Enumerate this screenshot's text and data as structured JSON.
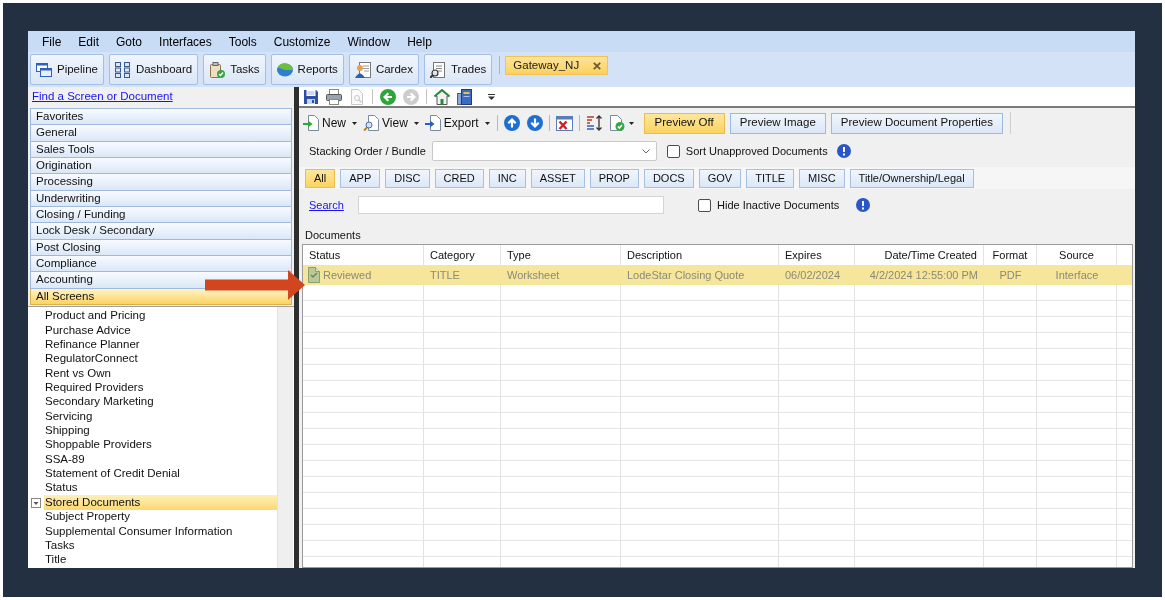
{
  "menu_bar": [
    "File",
    "Edit",
    "Goto",
    "Interfaces",
    "Tools",
    "Customize",
    "Window",
    "Help"
  ],
  "toolbar": [
    "Pipeline",
    "Dashboard",
    "Tasks",
    "Reports",
    "Cardex",
    "Trades"
  ],
  "open_tabs": [
    {
      "label": "Gateway_NJ",
      "selected": true
    }
  ],
  "left_panel": {
    "find_link": "Find a Screen or Document",
    "categories": [
      {
        "label": "Favorites",
        "selected": false
      },
      {
        "label": "General",
        "selected": false
      },
      {
        "label": "Sales Tools",
        "selected": false
      },
      {
        "label": "Origination",
        "selected": false
      },
      {
        "label": "Processing",
        "selected": false
      },
      {
        "label": "Underwriting",
        "selected": false
      },
      {
        "label": "Closing / Funding",
        "selected": false
      },
      {
        "label": "Lock Desk / Secondary",
        "selected": false
      },
      {
        "label": "Post Closing",
        "selected": false
      },
      {
        "label": "Compliance",
        "selected": false
      },
      {
        "label": "Accounting",
        "selected": false
      },
      {
        "label": "All Screens",
        "selected": true
      }
    ],
    "screens": [
      {
        "label": "Product and Pricing",
        "selected": false
      },
      {
        "label": "Purchase Advice",
        "selected": false
      },
      {
        "label": "Refinance Planner",
        "selected": false
      },
      {
        "label": "RegulatorConnect",
        "selected": false
      },
      {
        "label": "Rent vs Own",
        "selected": false
      },
      {
        "label": "Required Providers",
        "selected": false
      },
      {
        "label": "Secondary Marketing",
        "selected": false
      },
      {
        "label": "Servicing",
        "selected": false
      },
      {
        "label": "Shipping",
        "selected": false
      },
      {
        "label": "Shoppable Providers",
        "selected": false
      },
      {
        "label": "SSA-89",
        "selected": false
      },
      {
        "label": "Statement of Credit Denial",
        "selected": false
      },
      {
        "label": "Status",
        "selected": false
      },
      {
        "label": "Stored Documents",
        "selected": true
      },
      {
        "label": "Subject Property",
        "selected": false
      },
      {
        "label": "Supplemental Consumer Information",
        "selected": false
      },
      {
        "label": "Tasks",
        "selected": false
      },
      {
        "label": "Title",
        "selected": false
      }
    ]
  },
  "quick_toolbar": [
    {
      "disabled": false
    },
    {
      "disabled": false
    },
    {
      "disabled": true
    },
    {
      "disabled": false
    },
    {
      "disabled": true
    },
    {
      "disabled": false
    },
    {
      "disabled": false
    }
  ],
  "document_toolbar": {
    "menus": [
      "New",
      "View",
      "Export"
    ],
    "preview_buttons": [
      {
        "label": "Preview Off",
        "selected": true
      },
      {
        "label": "Preview Image",
        "selected": false
      },
      {
        "label": "Preview Document Properties",
        "selected": false
      }
    ]
  },
  "stacking_order": {
    "label": "Stacking Order / Bundle"
  },
  "sort_unapproved": {
    "label": "Sort Unapproved Documents",
    "checked": false
  },
  "filters": [
    {
      "label": "All",
      "selected": true
    },
    {
      "label": "APP",
      "selected": false
    },
    {
      "label": "DISC",
      "selected": false
    },
    {
      "label": "CRED",
      "selected": false
    },
    {
      "label": "INC",
      "selected": false
    },
    {
      "label": "ASSET",
      "selected": false
    },
    {
      "label": "PROP",
      "selected": false
    },
    {
      "label": "DOCS",
      "selected": false
    },
    {
      "label": "GOV",
      "selected": false
    },
    {
      "label": "TITLE",
      "selected": false
    },
    {
      "label": "MISC",
      "selected": false
    },
    {
      "label": "Title/Ownership/Legal",
      "selected": false
    }
  ],
  "search": {
    "link": "Search"
  },
  "hide_inactive": {
    "label": "Hide Inactive Documents",
    "checked": false
  },
  "documents": {
    "title": "Documents",
    "columns": [
      "Status",
      "Category",
      "Type",
      "Description",
      "Expires",
      "Date/Time Created",
      "Format",
      "Source"
    ],
    "rows": [
      {
        "selected": true,
        "cells": [
          "Reviewed",
          "TITLE",
          "Worksheet",
          "LodeStar Closing Quote",
          "06/02/2024",
          "4/2/2024 12:55:00 PM",
          "PDF",
          "Interface"
        ]
      }
    ]
  },
  "annotations": [
    {
      "kind": "arrow"
    }
  ]
}
